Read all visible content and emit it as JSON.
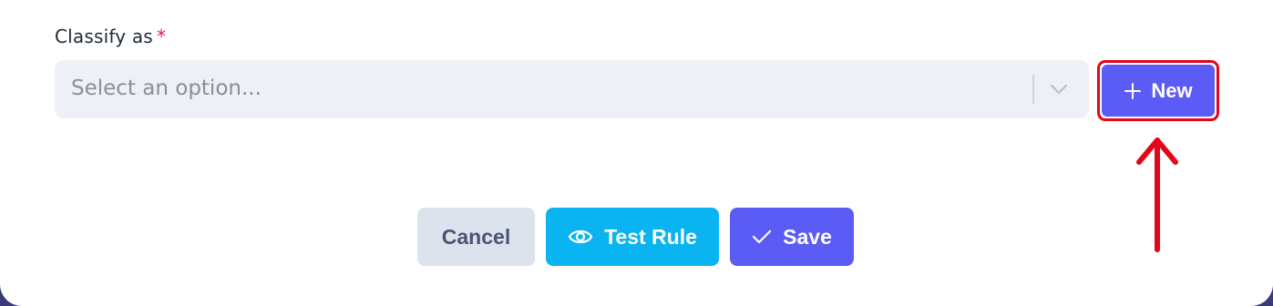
{
  "form": {
    "field_label": "Classify as",
    "required_marker": "*",
    "select": {
      "placeholder": "Select an option..."
    },
    "new_button_label": "New"
  },
  "actions": {
    "cancel_label": "Cancel",
    "test_rule_label": "Test Rule",
    "save_label": "Save"
  },
  "annotation": {
    "highlight_color": "#e3061a"
  },
  "icons": {
    "chevron": "chevron-down-icon",
    "plus": "plus-icon",
    "eye": "eye-icon",
    "check": "check-icon",
    "arrow": "arrow-up-icon"
  },
  "colors": {
    "primary": "#5b5bf5",
    "info": "#0ab4f0",
    "secondary": "#dde3ed",
    "input_bg": "#edf1f5",
    "required": "#e11d48"
  }
}
